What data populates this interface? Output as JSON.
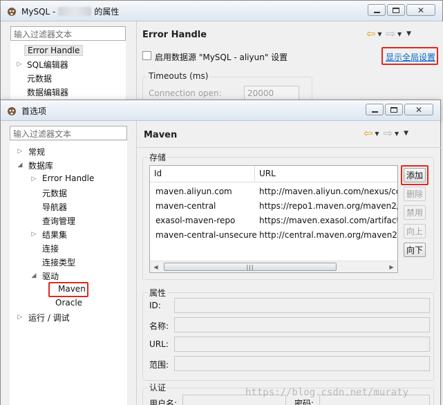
{
  "back_window": {
    "title_prefix": "MySQL -",
    "title_suffix": "的属性",
    "filter_placeholder": "输入过滤器文本",
    "tree": [
      "Error Handle",
      "SQL编辑器",
      "元数据",
      "数据编辑器"
    ],
    "heading": "Error Handle",
    "enable_checkbox_label": "启用数据源 \"MySQL - aliyun\" 设置",
    "global_settings_link": "显示全局设置",
    "timeouts_group": "Timeouts (ms)",
    "connection_open_label": "Connection open:",
    "connection_open_value": "20000"
  },
  "front_window": {
    "title": "首选项",
    "filter_placeholder": "输入过滤器文本",
    "tree": {
      "general": "常规",
      "database": "数据库",
      "error_handle": "Error Handle",
      "metadata": "元数据",
      "navigator": "导航器",
      "query_manager": "查询管理",
      "resultset": "结果集",
      "connection": "连接",
      "connection_types": "连接类型",
      "drivers": "驱动",
      "maven": "Maven",
      "oracle": "Oracle",
      "run_debug": "运行 / 调试"
    },
    "heading": "Maven",
    "storage_group": "存储",
    "table": {
      "headers": [
        "Id",
        "URL"
      ],
      "rows": [
        [
          "maven.aliyun.com",
          "http://maven.aliyun.com/nexus/cor"
        ],
        [
          "maven-central",
          "https://repo1.maven.org/maven2/"
        ],
        [
          "exasol-maven-repo",
          "https://maven.exasol.com/artifacto"
        ],
        [
          "maven-central-unsecure",
          "http://central.maven.org/maven2/"
        ]
      ]
    },
    "buttons": {
      "add": "添加",
      "delete": "删除",
      "disable": "禁用",
      "up": "向上",
      "down": "向下"
    },
    "props_group": "属性",
    "props": {
      "id": "ID:",
      "name": "名称:",
      "url": "URL:",
      "scope": "范围:"
    },
    "auth_group": "认证",
    "auth": {
      "username": "用户名:",
      "password": "密码:"
    }
  },
  "watermark": "https://blog.csdn.net/muraty"
}
